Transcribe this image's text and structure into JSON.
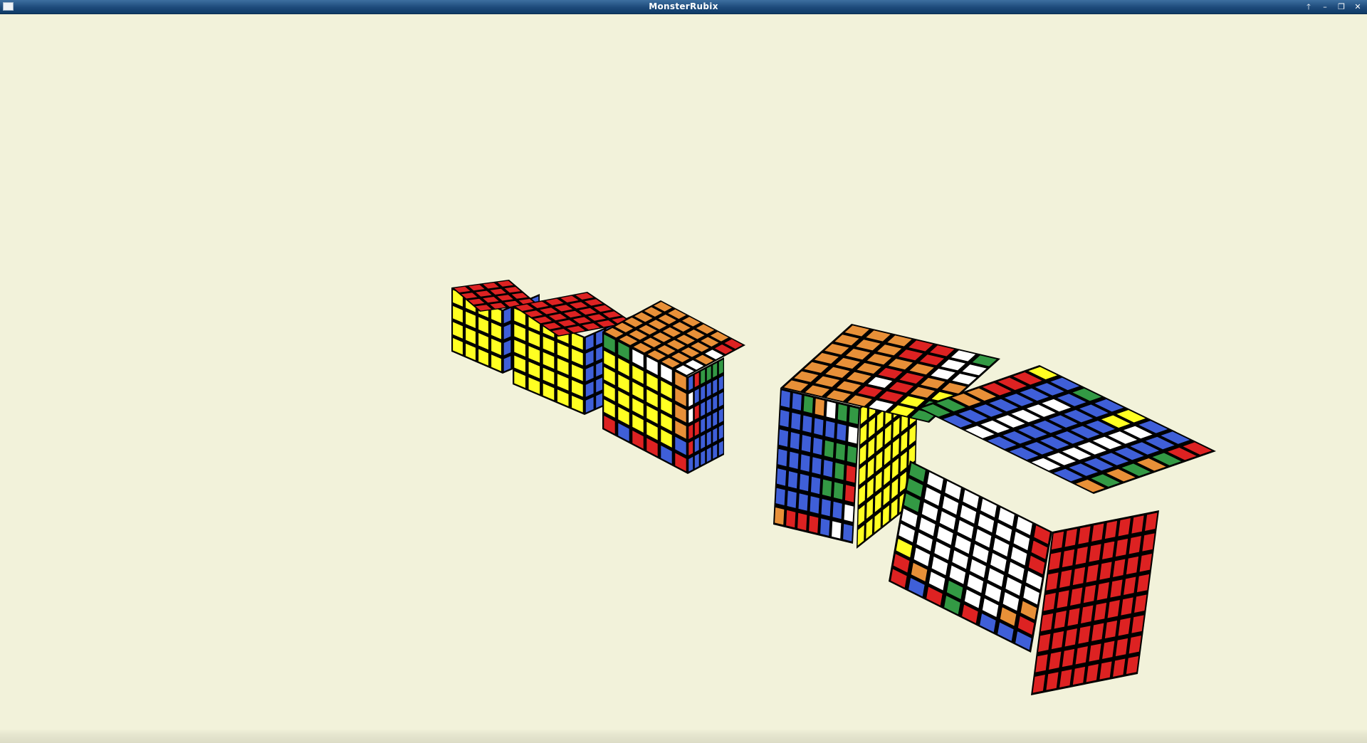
{
  "window": {
    "title": "MonsterRubix",
    "controls": {
      "shade_icon": "arrow-up-icon",
      "shade_glyph": "🡑",
      "minimize_icon": "minimize-icon",
      "minimize_glyph": "–",
      "maximize_icon": "maximize-icon",
      "maximize_glyph": "❐",
      "close_icon": "close-icon",
      "close_glyph": "✕"
    }
  },
  "colors": {
    "background": "#f2f2da",
    "titlebar": "#1d4a7a",
    "sticker_white": "#ffffff",
    "sticker_yellow": "#ffff22",
    "sticker_red": "#dd2222",
    "sticker_orange": "#e89038",
    "sticker_green": "#339944",
    "sticker_blue": "#3f5fd8",
    "cube_body": "#000000"
  },
  "cubes": [
    {
      "name": "cube-4x4",
      "size": 4,
      "faces": {
        "top": "R",
        "front": "Y",
        "right": "B"
      }
    },
    {
      "name": "cube-5x5",
      "size": 5,
      "faces": {
        "top": "R",
        "front": "Y",
        "right": "B"
      }
    },
    {
      "name": "cube-6x6",
      "size": 6,
      "faces": {
        "top": [
          "OOOOOO",
          "OOOOOO",
          "OOOOOO",
          "OOOOOO",
          "OOOOOO",
          "WWOWRR"
        ],
        "front": [
          "GGWWWO",
          "YYYYYO",
          "YYYYYO",
          "YYYYYO",
          "YYYYYB",
          "RBRRBR"
        ],
        "right": [
          "BRGGGG",
          "WBBBBB",
          "WRBBBB",
          "RRBBBB",
          "RBBBBB",
          "BBBBBB"
        ]
      }
    },
    {
      "name": "cube-7x7",
      "size": 7,
      "faces": {
        "top": [
          "OOOOOOO",
          "OOOOOOO",
          "OOOOOOO",
          "ORWRORR",
          "WRRRORR",
          "YYOOWWW",
          "GGYOWWG"
        ],
        "front": [
          "BBGOWGG",
          "BBBBBBW",
          "BBBBGGG",
          "BBBBBGR",
          "BBBBGGR",
          "BBBBBBW",
          "ORRRBWB"
        ],
        "right": [
          "YYYYYYY",
          "YYYYYYY",
          "YYYYYYY",
          "YYYYYYY",
          "YYYYYYY",
          "YYYYYYY",
          "YYYYYYY"
        ]
      }
    },
    {
      "name": "cube-8x8",
      "size": 8,
      "faces": {
        "top": [
          "GGOORRRY",
          "BBBBBBBB",
          "WWWWWWBG",
          "BBBBBBBB",
          "BBBBBBYY",
          "WWWWWWWB",
          "BBBBBBBB",
          "OGOGOGRR"
        ],
        "front": [
          "GWWWWWWR",
          "GWWWWWWR",
          "GWWWWWWR",
          "WWWWWWWW",
          "WWWWWWWW",
          "YWWWWWWO",
          "ROWGWWOR",
          "RBRGRBBB"
        ],
        "right": [
          "RRRRRRRR",
          "RRRRRRRR",
          "RRRRRRRR",
          "RRRRRRRR",
          "RRRRRRRR",
          "RRRRRRRR",
          "RRRRRRRR",
          "RRRRRRRR"
        ]
      }
    }
  ]
}
